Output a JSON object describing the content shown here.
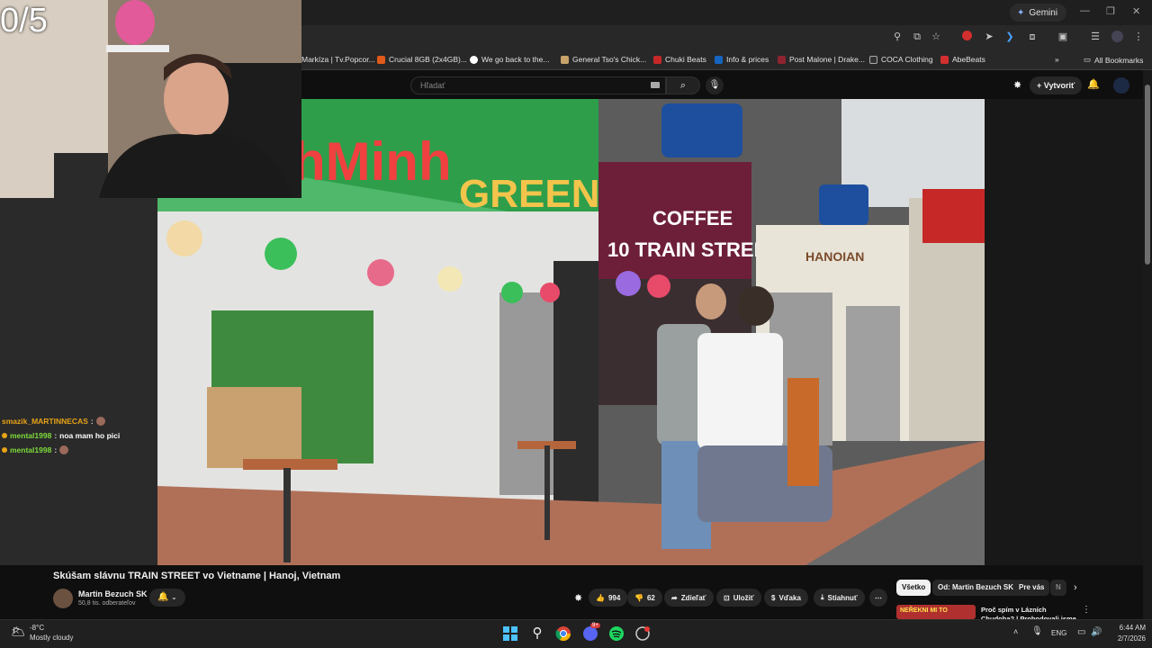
{
  "stream": {
    "counter": "0/5"
  },
  "browser": {
    "gemini_label": "Gemini",
    "bookmarks": [
      {
        "label": "Markíza | Tv.Popcor...",
        "color": "#3a3a3a"
      },
      {
        "label": "Crucial 8GB (2x4GB)...",
        "color": "#e05a1a"
      },
      {
        "label": "We go back to the...",
        "color": "#ffffff"
      },
      {
        "label": "General Tso's Chick...",
        "color": "#c9a36b"
      },
      {
        "label": "Chuki Beats",
        "color": "#c62828"
      },
      {
        "label": "Info & prices",
        "color": "#1565c0"
      },
      {
        "label": "Post Malone | Drake...",
        "color": "#8e2430"
      },
      {
        "label": "COCA Clothing",
        "color": "#333333"
      },
      {
        "label": "AbeBeats",
        "color": "#d32f2f"
      }
    ],
    "all_bookmarks": "All Bookmarks"
  },
  "youtube": {
    "search_placeholder": "Hľadať",
    "create_label": "Vytvoriť",
    "video_title": "Skúšam slávnu TRAIN STREET vo Vietname | Hanoj, Vietnam",
    "channel_name": "Martin Bezuch SK",
    "subscribers": "50,8 tis. odberateľov",
    "likes": "994",
    "dislikes": "62",
    "share_label": "Zdieľať",
    "save_label": "Uložiť",
    "thanks_label": "Vďaka",
    "download_label": "Stiahnuť",
    "chips": [
      "Všetko",
      "Od: Martin Bezuch SK",
      "Pre vás",
      "N"
    ],
    "recommendation_title": "Proč spím v Lázních Chudoba? | Prohodovali jsme v | Pyvní",
    "rec_thumb_text": "NEŘEKNI MI TO"
  },
  "chat": [
    {
      "user": "smazik_MARTINNECAS",
      "message": "",
      "color": "#e8a317",
      "badge": false
    },
    {
      "user": "mental1998",
      "message": "noa mam ho pici",
      "color": "#7ddb3a",
      "badge": true
    },
    {
      "user": "mental1998",
      "message": "",
      "color": "#7ddb3a",
      "badge": true
    }
  ],
  "taskbar": {
    "temperature": "-8°C",
    "weather": "Mostly cloudy",
    "language": "ENG",
    "time": "6:44 AM",
    "date": "2/7/2026",
    "discord_badge": "9+"
  }
}
